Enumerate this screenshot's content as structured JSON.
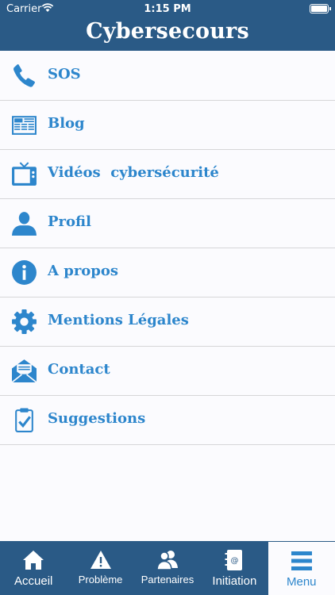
{
  "status": {
    "carrier": "Carrier",
    "time": "1:15 PM"
  },
  "header": {
    "title": "Cybersecours"
  },
  "menu": {
    "items": [
      {
        "label": "SOS",
        "icon": "phone-icon"
      },
      {
        "label": "Blog",
        "icon": "newspaper-icon"
      },
      {
        "label": "Vidéos  cybersécurité",
        "icon": "tv-icon"
      },
      {
        "label": "Profil",
        "icon": "user-icon"
      },
      {
        "label": "A propos",
        "icon": "info-icon"
      },
      {
        "label": "Mentions Légales",
        "icon": "gear-icon"
      },
      {
        "label": "Contact",
        "icon": "envelope-icon"
      },
      {
        "label": "Suggestions",
        "icon": "clipboard-check-icon"
      }
    ]
  },
  "tabbar": {
    "tabs": [
      {
        "label": "Accueil",
        "icon": "home-icon"
      },
      {
        "label": "Problème",
        "icon": "warning-icon"
      },
      {
        "label": "Partenaires",
        "icon": "partners-icon"
      },
      {
        "label": "Initiation",
        "icon": "address-book-icon"
      },
      {
        "label": "Menu",
        "icon": "hamburger-icon",
        "active": true
      }
    ]
  },
  "colors": {
    "header_bg": "#2a5a86",
    "accent": "#2d86cc",
    "background": "#fbfbfe"
  }
}
